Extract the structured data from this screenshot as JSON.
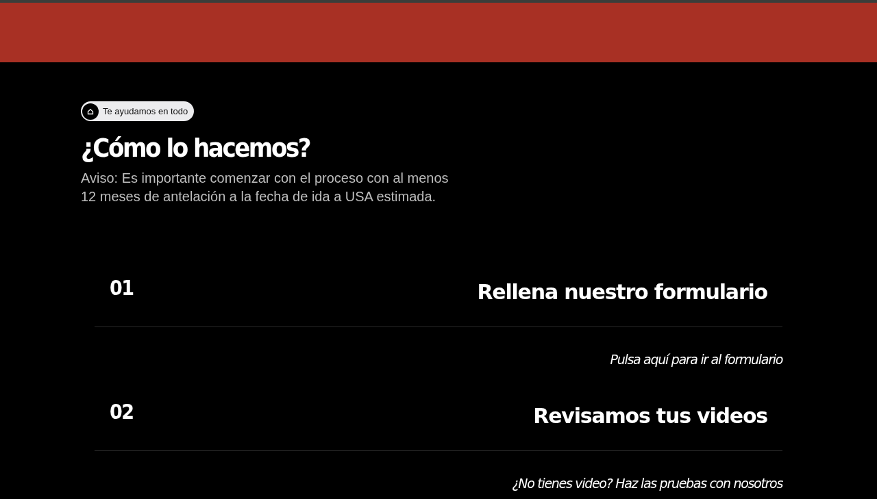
{
  "badge": {
    "label": "Te ayudamos en todo"
  },
  "heading": "¿Cómo lo hacemos?",
  "notice": "Aviso: Es importante comenzar con el proceso con al menos 12 meses de antelación a la fecha de ida a USA estimada.",
  "steps": [
    {
      "number": "01",
      "title": "Rellena nuestro formulario",
      "link": "Pulsa aquí para ir al formulario"
    },
    {
      "number": "02",
      "title": "Revisamos tus videos",
      "link": "¿No tienes video? Haz las pruebas con nosotros"
    }
  ]
}
